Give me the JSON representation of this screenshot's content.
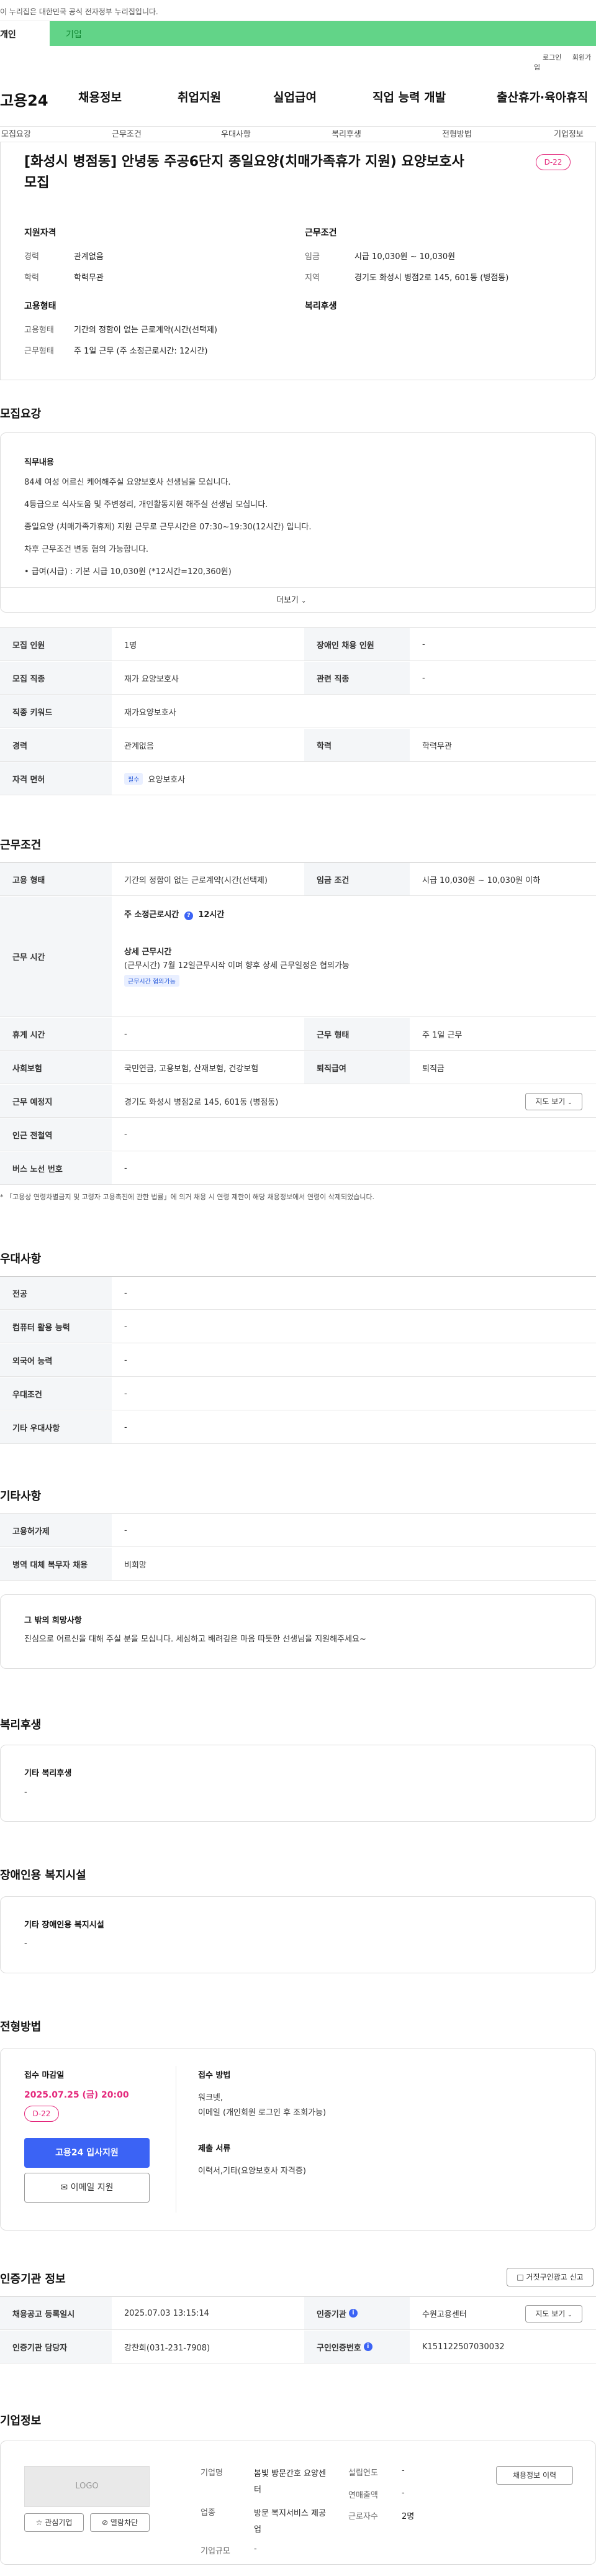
{
  "top": {
    "gov_banner": "이 누리집은 대한민국 공식 전자정부 누리집입니다.",
    "tab_personal": "개인",
    "tab_company": "기업",
    "login": "로그인",
    "join": "회원가입"
  },
  "gnb": {
    "logo": "고용24",
    "items": [
      "채용정보",
      "취업지원",
      "실업급여",
      "직업 능력 개발",
      "출산휴가·육아휴직"
    ]
  },
  "subnav": [
    "모집요강",
    "근무조건",
    "우대사항",
    "복리후생",
    "전형방법",
    "기업정보"
  ],
  "summary": {
    "title": "[화성시 병점동] 안녕동 주공6단지 종일요양(치매가족휴가 지원) 요양보호사 모집",
    "dday": "D-22",
    "qual_heading": "지원자격",
    "experience_label": "경력",
    "experience_value": "관계없음",
    "education_label": "학력",
    "education_value": "학력무관",
    "cond_heading": "근무조건",
    "wage_label": "임금",
    "wage_value": "시급 10,030원 ~ 10,030원",
    "location_label": "지역",
    "location_value": "경기도 화성시 병점2로 145, 601동 (병점동)",
    "employ_heading": "고용형태",
    "employ_type_label": "고용형태",
    "employ_type_value": "기간의 정함이 없는 근로계약(시간(선택제)",
    "work_type_label": "근무형태",
    "work_type_value": "주 1일 근무 (주 소정근로시간: 12시간)",
    "welfare_heading": "복리후생"
  },
  "recruit": {
    "section_title": "모집요강",
    "duty_heading": "직무내용",
    "duty_lines": [
      "84세 여성 어르신 케어해주실 요양보호사 선생님을 모십니다.",
      "4등급으로 식사도움 및 주변정리, 개인활동지원 해주실 선생님 모십니다.",
      "종일요양 (치매가족가휴제) 지원 근무로 근무시간은 07:30~19:30(12시간) 입니다.",
      "차후 근무조건 변동 협의 가능합니다.",
      "• 급여(시급) : 기본 시급 10,030원 (*12시간=120,360원)"
    ],
    "more": "더보기",
    "rows": [
      {
        "th1": "모집 인원",
        "td1": "1명",
        "th2": "장애인 채용 인원",
        "td2": "-"
      },
      {
        "th1": "모집 직종",
        "td1": "재가 요양보호사",
        "th2": "관련 직종",
        "td2": "-"
      },
      {
        "th1": "직종 키워드",
        "td1": "재가요양보호사"
      },
      {
        "th1": "경력",
        "td1": "관계없음",
        "th2": "학력",
        "td2": "학력무관"
      },
      {
        "th1": "자격 면허",
        "td1_chip": "필수",
        "td1": "요양보호사"
      }
    ]
  },
  "conditions": {
    "section_title": "근무조건",
    "employ_label": "고용 형태",
    "employ_value": "기간의 정함이 없는 근로계약(시간(선택제)",
    "wage_label": "임금 조건",
    "wage_value": "시급 10,030원 ~ 10,030원 이하",
    "hours_label": "근무 시간",
    "weekly_hours": "주 소정근로시간",
    "weekly_hours_value": "12시간",
    "detail_heading": "상세 근무시간",
    "detail_value": "(근무시간) 7월 12일근무시작 이며 향후 상세 근무일정은 협의가능",
    "detail_chip": "근무시간 협의가능",
    "break_label": "휴게 시간",
    "break_value": "-",
    "work_form_label": "근무 형태",
    "work_form_value": "주 1일 근무",
    "insurance_label": "사회보험",
    "insurance_value": "국민연금, 고용보험, 산재보험, 건강보험",
    "retire_label": "퇴직급여",
    "retire_value": "퇴직금",
    "place_label": "근무 예정지",
    "place_value": "경기도 화성시 병점2로 145, 601동 (병점동)",
    "map_btn": "지도 보기",
    "subway_label": "인근 전철역",
    "subway_value": "-",
    "bus_label": "버스 노선 번호",
    "bus_value": "-",
    "note": "* 「고용상 연령차별금지 및 고령자 고용촉진에 관한 법률」에 의거 채용 시 연령 제한이 해당 채용정보에서 연령이 삭제되었습니다."
  },
  "preference": {
    "section_title": "우대사항",
    "rows": [
      {
        "th": "전공",
        "td": "-"
      },
      {
        "th": "컴퓨터 활용 능력",
        "td": "-"
      },
      {
        "th": "외국어 능력",
        "td": "-"
      },
      {
        "th": "우대조건",
        "td": "-"
      },
      {
        "th": "기타 우대사항",
        "td": "-"
      }
    ]
  },
  "etc": {
    "section_title": "기타사항",
    "rows": [
      {
        "th": "고용허가제",
        "td": "-"
      },
      {
        "th": "병역 대체 복무자 채용",
        "td": "비희망"
      }
    ],
    "box_title": "그 밖의 희망사항",
    "box_text": "진심으로 어르신을 대해 주실 분을 모십니다. 세심하고 배려깊은 마음 따듯한 선생님을 지원해주세요~"
  },
  "welfare": {
    "section_title": "복리후생",
    "box_title": "기타 복리후생",
    "box_value": "-"
  },
  "disability": {
    "section_title": "장애인용 복지시설",
    "box_title": "기타 장애인용 복지시설",
    "box_value": "-"
  },
  "selection": {
    "section_title": "전형방법",
    "deadline_label": "접수 마감일",
    "deadline_value": "2025.07.25 (금) 20:00",
    "dday": "D-22",
    "apply_btn": "고용24 입사지원",
    "email_btn": "이메일 지원",
    "method_label": "접수 방법",
    "method_line1": "워크넷,",
    "method_line2": "이메일 (개인회원 로그인 후 조회가능)",
    "docs_label": "제출 서류",
    "docs_value": "이력서,기타(요양보호사 자격증)"
  },
  "cert": {
    "section_title": "인증기관 정보",
    "report_btn": "거짓구인광고 신고",
    "reg_date_label": "채용공고 등록일시",
    "reg_date_value": "2025.07.03 13:15:14",
    "org_label": "인증기관",
    "org_value": "수원고용센터",
    "map_btn": "지도 보기",
    "manager_label": "인증기관 담당자",
    "manager_value": "강찬희(031-231-7908)",
    "cert_no_label": "구인인증번호",
    "cert_no_value": "K151122507030032"
  },
  "company": {
    "section_title": "기업정보",
    "logo_text": "LOGO",
    "interest_btn": "관심기업",
    "block_btn": "열람차단",
    "name_label": "기업명",
    "name_value": "봄빛 방문간호 요양센터",
    "industry_label": "업종",
    "industry_value": "방문 복지서비스 제공업",
    "size_label": "기업규모",
    "size_value": "-",
    "founded_label": "설립연도",
    "founded_value": "-",
    "sales_label": "연매출액",
    "sales_value": "-",
    "employees_label": "근로자수",
    "employees_value": "2명",
    "jobs_btn": "채용정보 이력"
  }
}
